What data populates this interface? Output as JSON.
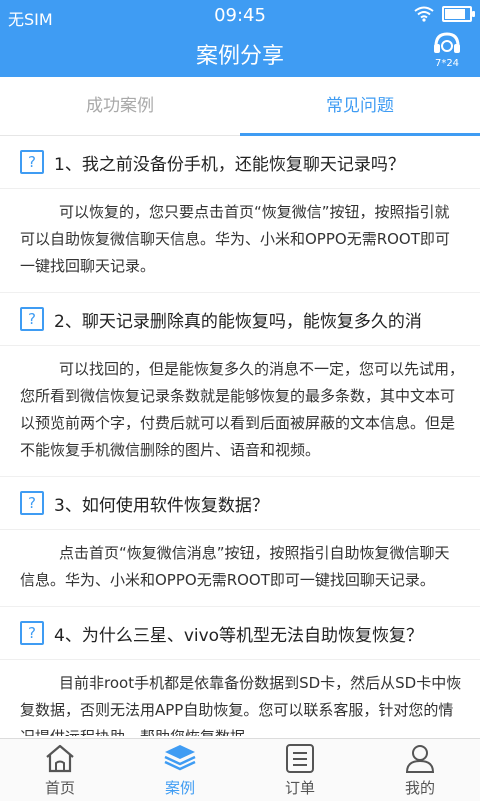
{
  "status_bar": {
    "carrier": "无SIM",
    "time": "09:45"
  },
  "header": {
    "title": "案例分享",
    "service_text": "7*24"
  },
  "tabs": [
    {
      "label": "成功案例",
      "active": false
    },
    {
      "label": "常见问题",
      "active": true
    }
  ],
  "faq": {
    "question_icon": "?",
    "items": [
      {
        "question": "1、我之前没备份手机，还能恢复聊天记录吗？",
        "answer": "可以恢复的，您只要点击首页“恢复微信”按钮，按照指引就可以自助恢复微信聊天信息。华为、小米和OPPO无需ROOT即可一键找回聊天记录。"
      },
      {
        "question": "2、聊天记录删除真的能恢复吗，能恢复多久的消",
        "answer": "可以找回的，但是能恢复多久的消息不一定，您可以先试用，您所看到微信恢复记录条数就是能够恢复的最多条数，其中文本可以预览前两个字，付费后就可以看到后面被屏蔽的文本信息。但是不能恢复手机微信删除的图片、语音和视频。"
      },
      {
        "question": "3、如何使用软件恢复数据？",
        "answer": "点击首页“恢复微信消息”按钮，按照指引自助恢复微信聊天信息。华为、小米和OPPO无需ROOT即可一键找回聊天记录。"
      },
      {
        "question": "4、为什么三星、vivo等机型无法自助恢复恢复？",
        "answer": "目前非root手机都是依靠备份数据到SD卡，然后从SD卡中恢复数据，否则无法用APP自助恢复。您可以联系客服，针对您的情况提供远程协助，帮助您恢复数据。"
      }
    ]
  },
  "bottom_nav": [
    {
      "label": "首页",
      "icon": "home-icon",
      "active": false
    },
    {
      "label": "案例",
      "icon": "layers-icon",
      "active": true
    },
    {
      "label": "订单",
      "icon": "order-list-icon",
      "active": false
    },
    {
      "label": "我的",
      "icon": "user-icon",
      "active": false
    }
  ],
  "colors": {
    "accent": "#3f9cf3",
    "inactive_tab": "#a9a9a9"
  }
}
